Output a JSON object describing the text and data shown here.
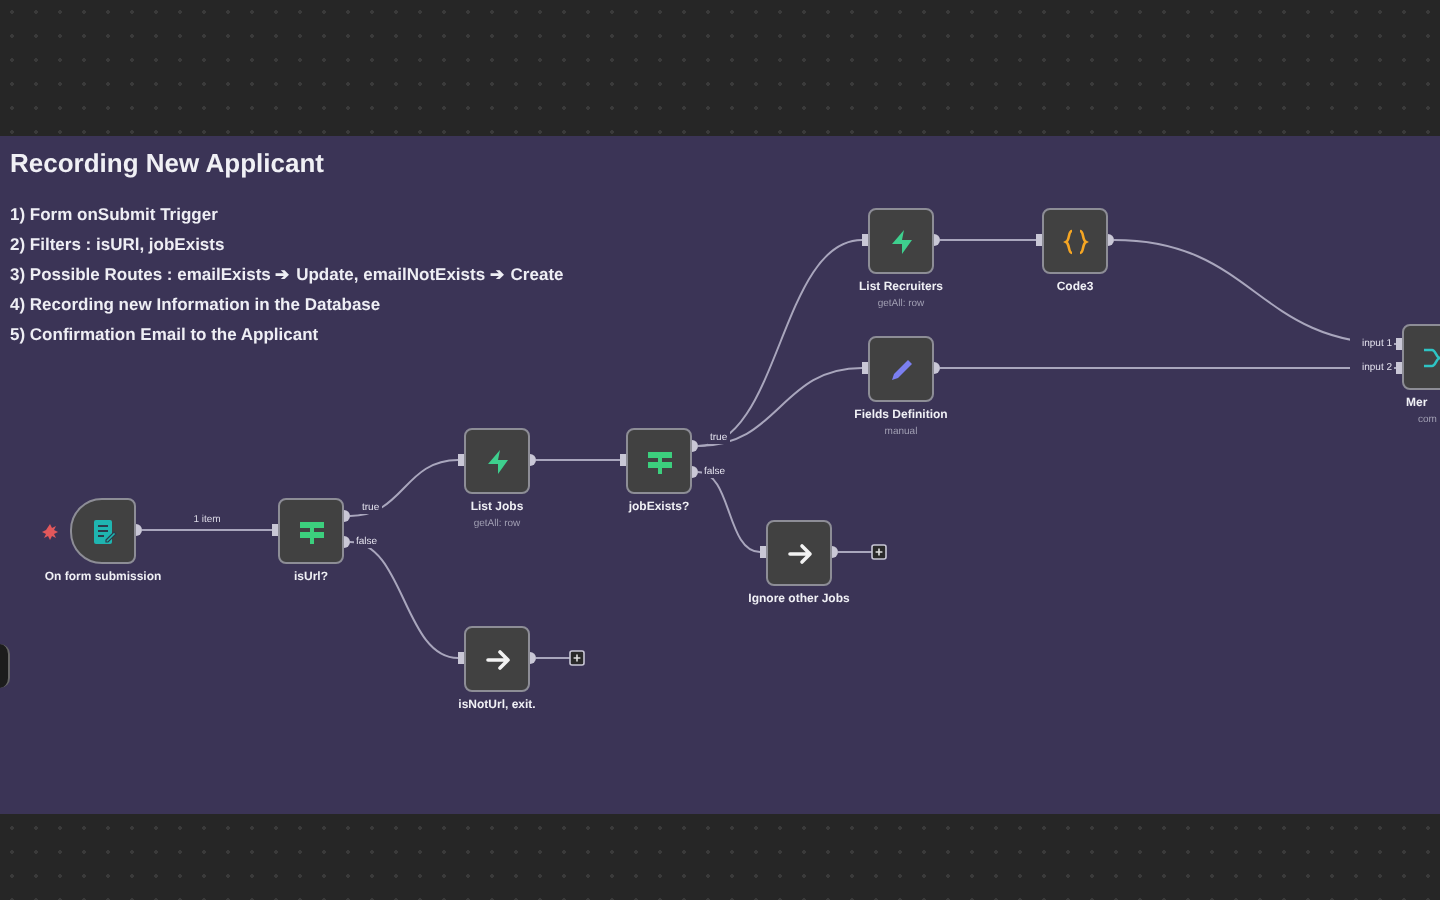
{
  "sticky_note": {
    "title": "Recording New Applicant",
    "lines": [
      "1) Form onSubmit Trigger",
      "2) Filters : isURl, jobExists",
      "3) Possible Routes : emailExists ➔ Update, emailNotExists ➔ Create",
      "4) Recording new Information in the Database",
      "5) Confirmation Email to the Applicant"
    ]
  },
  "nodes": [
    {
      "kind": "trigger",
      "label": "On form submission",
      "output_label": "1 item"
    },
    {
      "kind": "if",
      "label": "isUrl?",
      "outputs": [
        "true",
        "false"
      ]
    },
    {
      "kind": "action",
      "label": "List Jobs",
      "subtitle": "getAll: row"
    },
    {
      "kind": "end",
      "label": "isNotUrl, exit."
    },
    {
      "kind": "if",
      "label": "jobExists?",
      "outputs": [
        "true",
        "false"
      ]
    },
    {
      "kind": "end",
      "label": "Ignore other Jobs"
    },
    {
      "kind": "action",
      "label": "List Recruiters",
      "subtitle": "getAll: row"
    },
    {
      "kind": "action",
      "label": "Code3"
    },
    {
      "kind": "action",
      "label": "Fields Definition",
      "subtitle": "manual"
    },
    {
      "kind": "merge",
      "label": "Mer",
      "subtitle": "com",
      "inputs": [
        "input 1",
        "input 2"
      ]
    }
  ]
}
